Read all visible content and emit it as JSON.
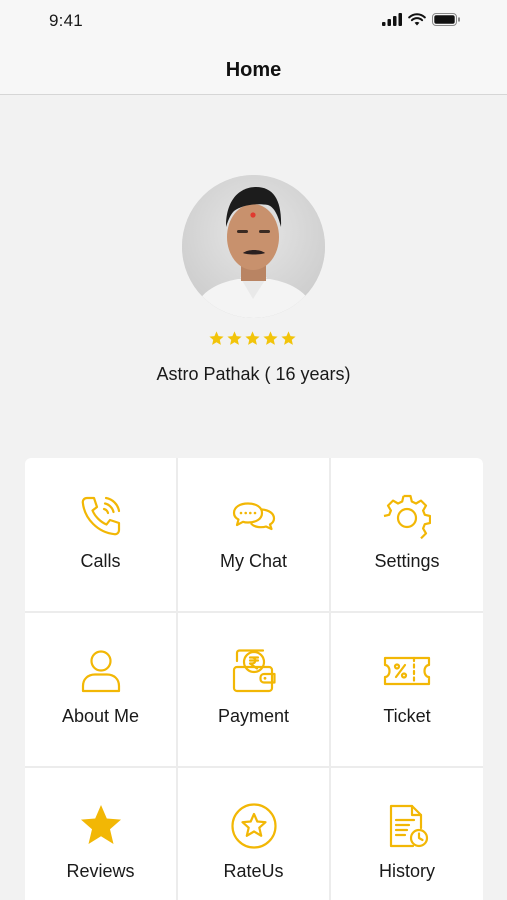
{
  "status_bar": {
    "time": "9:41"
  },
  "header": {
    "title": "Home"
  },
  "profile": {
    "name": "Astro Pathak ( 16 years)",
    "rating": 5,
    "rating_max": 5
  },
  "menu": [
    {
      "label": "Calls",
      "icon": "phone-icon"
    },
    {
      "label": "My Chat",
      "icon": "chat-bubbles-icon"
    },
    {
      "label": "Settings",
      "icon": "gear-icon"
    },
    {
      "label": "About Me",
      "icon": "user-icon"
    },
    {
      "label": "Payment",
      "icon": "rupee-wallet-icon"
    },
    {
      "label": "Ticket",
      "icon": "ticket-icon"
    },
    {
      "label": "Reviews",
      "icon": "star-icon"
    },
    {
      "label": "RateUs",
      "icon": "star-circle-icon"
    },
    {
      "label": "History",
      "icon": "document-clock-icon"
    }
  ],
  "colors": {
    "accent": "#f2b705",
    "background": "#f2f2f2",
    "tile": "#ffffff"
  }
}
